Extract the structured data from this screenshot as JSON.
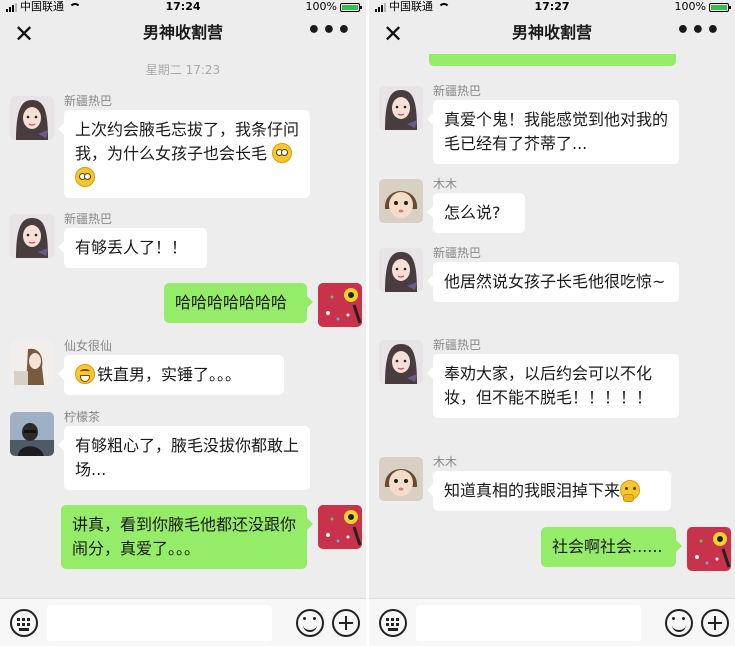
{
  "status_left": {
    "carrier": "中国联通",
    "time": "17:24",
    "battery": "100%",
    "battery_level": 1.0
  },
  "status_right": {
    "carrier": "中国联通",
    "time": "17:27",
    "battery": "100%",
    "battery_level": 1.0
  },
  "nav": {
    "title": "男神收割营",
    "close_glyph": "✕",
    "more_glyph": "•••"
  },
  "left_chat": {
    "timestamp": "星期二 17:23",
    "messages": [
      {
        "sender": "新疆热巴",
        "text": "上次约会腋毛忘拔了，我条仔问我，为什么女孩子也会长毛"
      },
      {
        "sender": "新疆热巴",
        "text": "有够丢人了！！"
      },
      {
        "text": "哈哈哈哈哈哈哈"
      },
      {
        "sender": "仙女很仙",
        "text": "铁直男，实锤了。。。"
      },
      {
        "sender": "柠檬茶",
        "text": "有够粗心了，腋毛没拔你都敢上场..."
      },
      {
        "text": "讲真，看到你腋毛他都还没跟你闹分，真爱了。。。"
      }
    ]
  },
  "right_chat": {
    "messages": [
      {
        "sender": "新疆热巴",
        "text": "真爱个鬼！我能感觉到他对我的毛已经有了芥蒂了..."
      },
      {
        "sender": "木木",
        "text": "怎么说?"
      },
      {
        "sender": "新疆热巴",
        "text": "他居然说女孩子长毛他很吃惊~"
      },
      {
        "sender": "新疆热巴",
        "text": "奉劝大家，以后约会可以不化妆，但不能不脱毛！！！！！"
      },
      {
        "sender": "木木",
        "text": "知道真相的我眼泪掉下来"
      },
      {
        "text": "社会啊社会......"
      }
    ]
  },
  "icons": [
    "close-icon",
    "more-icon",
    "keyboard-icon",
    "emoji-icon",
    "plus-icon",
    "pleading-face-emoji",
    "grinning-face-emoji",
    "thinking-face-emoji"
  ],
  "colors": {
    "outgoing_bubble": "#95ec69",
    "incoming_bubble": "#ffffff",
    "chat_background": "#ededed"
  }
}
